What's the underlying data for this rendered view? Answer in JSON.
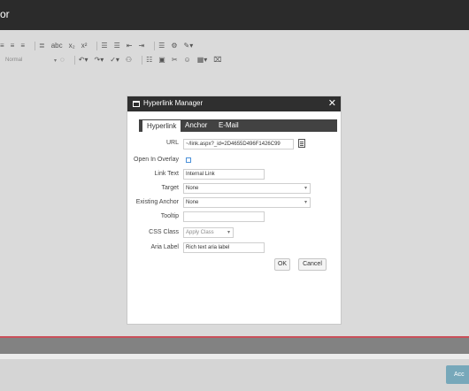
{
  "app": {
    "title": "or"
  },
  "toolbar": {
    "row1": [
      "≡",
      "≡",
      "≡",
      "≡",
      "≣",
      "abc",
      "x₂",
      "x²",
      "☰",
      "☰",
      "⇤",
      "⇥",
      "☰",
      "⚙",
      "✎▾"
    ],
    "font_size_value": "Normal",
    "row2": [
      "◌",
      "↶▾",
      "↷▾",
      "✓▾",
      "⚇",
      "☷",
      "▣",
      "✂",
      "☺",
      "▦▾",
      "⌧"
    ]
  },
  "dialog": {
    "title": "Hyperlink Manager",
    "close": "✕",
    "tabs": [
      "Hyperlink",
      "Anchor",
      "E-Mail"
    ],
    "fields": {
      "url_label": "URL",
      "url_value": "~/link.aspx?_id=2D4655D496F1426C99",
      "overlay_label": "Open In Overlay",
      "link_text_label": "Link Text",
      "link_text_value": "Internal Link",
      "target_label": "Target",
      "target_value": "None",
      "anchor_label": "Existing Anchor",
      "anchor_value": "None",
      "tooltip_label": "Tooltip",
      "tooltip_value": "",
      "css_label": "CSS Class",
      "css_value": "Apply Class",
      "aria_label": "Aria Label",
      "aria_value": "Rich text aria label"
    },
    "ok_label": "OK",
    "cancel_label": "Cancel"
  },
  "footer": {
    "accept_label": "Acc"
  }
}
